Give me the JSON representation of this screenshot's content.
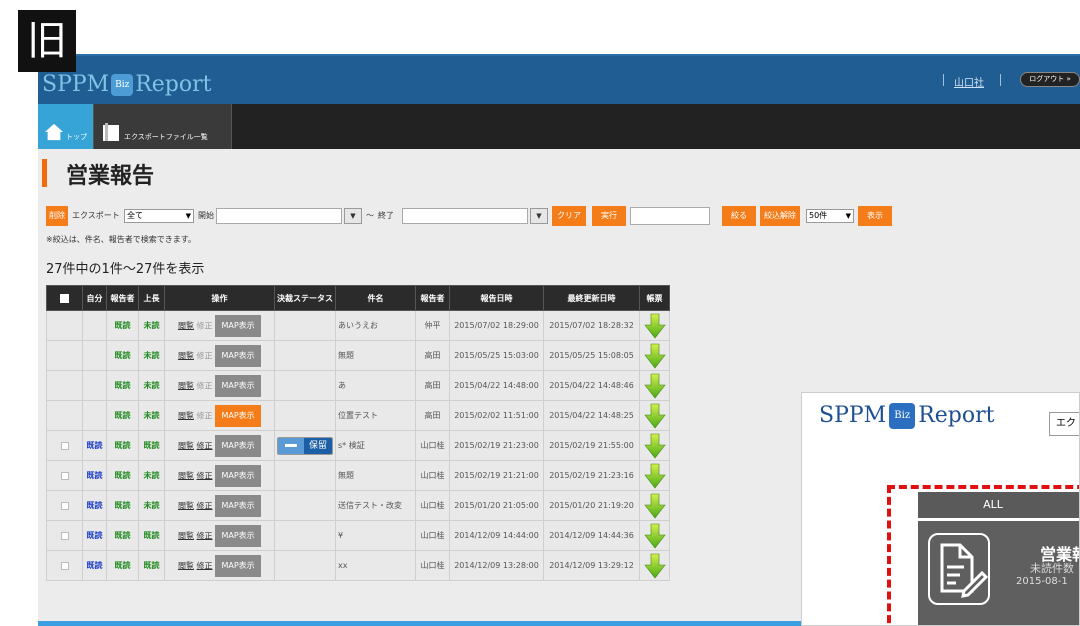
{
  "label": "旧",
  "header": {
    "brand_prefix": "SPPM",
    "brand_biz": "Biz",
    "brand_suffix": "Report",
    "user": "山口社",
    "logout": "ログアウト »"
  },
  "nav": {
    "top_label": "トップ",
    "export_label": "エクスポートファイル一覧"
  },
  "page": {
    "title": "営業報告",
    "note": "※絞込は、件名、報告者で検索できます。",
    "count": "27件中の1件～27件を表示"
  },
  "filters": {
    "delete": "削除",
    "export_label": "エクスポート",
    "export_value": "全て",
    "start_label": "開始",
    "tilde": "～",
    "end_label": "終了",
    "clear": "クリア",
    "execute": "実行",
    "narrow": "絞る",
    "reset": "絞込解除",
    "per_page": "50件",
    "display": "表示"
  },
  "table": {
    "headers": [
      "自分",
      "報告者",
      "上長",
      "操作",
      "決裁ステータス",
      "件名",
      "報告者",
      "報告日時",
      "最終更新日時",
      "帳票"
    ],
    "rows": [
      {
        "check": false,
        "self": "",
        "reporter": "既読",
        "boss": "未読",
        "view": "閲覧",
        "edit": "修正",
        "map": "MAP表示",
        "map_active": false,
        "status": "",
        "subject": "あいうえお",
        "name": "仲平",
        "reported": "2015/07/02 18:29:00",
        "updated": "2015/07/02 18:28:32"
      },
      {
        "check": false,
        "self": "",
        "reporter": "既読",
        "boss": "未読",
        "view": "閲覧",
        "edit": "修正",
        "map": "MAP表示",
        "map_active": false,
        "status": "",
        "subject": "無題",
        "name": "高田",
        "reported": "2015/05/25 15:03:00",
        "updated": "2015/05/25 15:08:05"
      },
      {
        "check": false,
        "self": "",
        "reporter": "既読",
        "boss": "未読",
        "view": "閲覧",
        "edit": "修正",
        "map": "MAP表示",
        "map_active": false,
        "status": "",
        "subject": "あ",
        "name": "高田",
        "reported": "2015/04/22 14:48:00",
        "updated": "2015/04/22 14:48:46"
      },
      {
        "check": false,
        "self": "",
        "reporter": "既読",
        "boss": "未読",
        "view": "閲覧",
        "edit": "修正",
        "map": "MAP表示",
        "map_active": true,
        "status": "",
        "subject": "位置テスト",
        "name": "高田",
        "reported": "2015/02/02 11:51:00",
        "updated": "2015/04/22 14:48:25"
      },
      {
        "check": true,
        "self": "既読",
        "reporter": "既読",
        "boss": "既読",
        "view": "閲覧",
        "edit": "修正",
        "map": "MAP表示",
        "map_active": false,
        "status": "保留",
        "subject": "s* 検証",
        "name": "山口桂",
        "reported": "2015/02/19 21:23:00",
        "updated": "2015/02/19 21:55:00"
      },
      {
        "check": true,
        "self": "既読",
        "reporter": "既読",
        "boss": "未読",
        "view": "閲覧",
        "edit": "修正",
        "map": "MAP表示",
        "map_active": false,
        "status": "",
        "subject": "無題",
        "name": "山口桂",
        "reported": "2015/02/19 21:21:00",
        "updated": "2015/02/19 21:23:16"
      },
      {
        "check": true,
        "self": "既読",
        "reporter": "既読",
        "boss": "未読",
        "view": "閲覧",
        "edit": "修正",
        "map": "MAP表示",
        "map_active": false,
        "status": "",
        "subject": "送信テスト・改変",
        "name": "山口桂",
        "reported": "2015/01/20 21:05:00",
        "updated": "2015/01/20 21:19:20"
      },
      {
        "check": true,
        "self": "既読",
        "reporter": "既読",
        "boss": "既読",
        "view": "閲覧",
        "edit": "修正",
        "map": "MAP表示",
        "map_active": false,
        "status": "",
        "subject": "¥",
        "name": "山口桂",
        "reported": "2014/12/09 14:44:00",
        "updated": "2014/12/09 14:44:36"
      },
      {
        "check": true,
        "self": "既読",
        "reporter": "既読",
        "boss": "既読",
        "view": "閲覧",
        "edit": "修正",
        "map": "MAP表示",
        "map_active": false,
        "status": "",
        "subject": "xx",
        "name": "山口桂",
        "reported": "2014/12/09 13:28:00",
        "updated": "2014/12/09 13:29:12"
      }
    ]
  },
  "overlay": {
    "brand_prefix": "SPPM",
    "brand_biz": "Biz",
    "brand_suffix": "Report",
    "select": "エク",
    "all": "ALL",
    "card_title": "営業報",
    "card_sub": "未読件数",
    "card_date": "2015-08-1"
  },
  "colors": {
    "header": "#1f5d93",
    "accent": "#f47d1a",
    "nav": "#222222",
    "read_blue": "#1a3cc7",
    "unread_green": "#1e8a1e",
    "dash_red": "#e01010"
  }
}
